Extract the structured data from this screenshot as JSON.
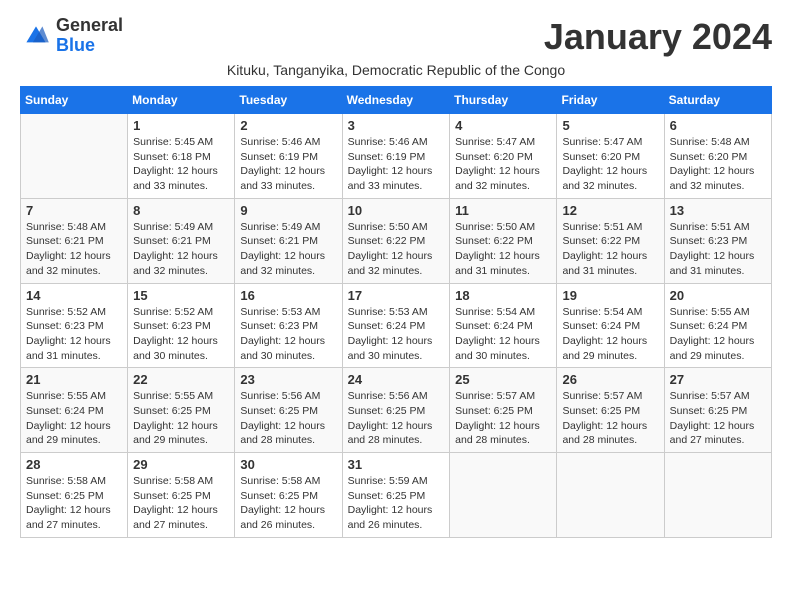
{
  "header": {
    "logo_general": "General",
    "logo_blue": "Blue",
    "title": "January 2024",
    "subtitle": "Kituku, Tanganyika, Democratic Republic of the Congo"
  },
  "calendar": {
    "days_of_week": [
      "Sunday",
      "Monday",
      "Tuesday",
      "Wednesday",
      "Thursday",
      "Friday",
      "Saturday"
    ],
    "weeks": [
      [
        {
          "day": "",
          "info": ""
        },
        {
          "day": "1",
          "info": "Sunrise: 5:45 AM\nSunset: 6:18 PM\nDaylight: 12 hours and 33 minutes."
        },
        {
          "day": "2",
          "info": "Sunrise: 5:46 AM\nSunset: 6:19 PM\nDaylight: 12 hours and 33 minutes."
        },
        {
          "day": "3",
          "info": "Sunrise: 5:46 AM\nSunset: 6:19 PM\nDaylight: 12 hours and 33 minutes."
        },
        {
          "day": "4",
          "info": "Sunrise: 5:47 AM\nSunset: 6:20 PM\nDaylight: 12 hours and 32 minutes."
        },
        {
          "day": "5",
          "info": "Sunrise: 5:47 AM\nSunset: 6:20 PM\nDaylight: 12 hours and 32 minutes."
        },
        {
          "day": "6",
          "info": "Sunrise: 5:48 AM\nSunset: 6:20 PM\nDaylight: 12 hours and 32 minutes."
        }
      ],
      [
        {
          "day": "7",
          "info": "Sunrise: 5:48 AM\nSunset: 6:21 PM\nDaylight: 12 hours and 32 minutes."
        },
        {
          "day": "8",
          "info": "Sunrise: 5:49 AM\nSunset: 6:21 PM\nDaylight: 12 hours and 32 minutes."
        },
        {
          "day": "9",
          "info": "Sunrise: 5:49 AM\nSunset: 6:21 PM\nDaylight: 12 hours and 32 minutes."
        },
        {
          "day": "10",
          "info": "Sunrise: 5:50 AM\nSunset: 6:22 PM\nDaylight: 12 hours and 32 minutes."
        },
        {
          "day": "11",
          "info": "Sunrise: 5:50 AM\nSunset: 6:22 PM\nDaylight: 12 hours and 31 minutes."
        },
        {
          "day": "12",
          "info": "Sunrise: 5:51 AM\nSunset: 6:22 PM\nDaylight: 12 hours and 31 minutes."
        },
        {
          "day": "13",
          "info": "Sunrise: 5:51 AM\nSunset: 6:23 PM\nDaylight: 12 hours and 31 minutes."
        }
      ],
      [
        {
          "day": "14",
          "info": "Sunrise: 5:52 AM\nSunset: 6:23 PM\nDaylight: 12 hours and 31 minutes."
        },
        {
          "day": "15",
          "info": "Sunrise: 5:52 AM\nSunset: 6:23 PM\nDaylight: 12 hours and 30 minutes."
        },
        {
          "day": "16",
          "info": "Sunrise: 5:53 AM\nSunset: 6:23 PM\nDaylight: 12 hours and 30 minutes."
        },
        {
          "day": "17",
          "info": "Sunrise: 5:53 AM\nSunset: 6:24 PM\nDaylight: 12 hours and 30 minutes."
        },
        {
          "day": "18",
          "info": "Sunrise: 5:54 AM\nSunset: 6:24 PM\nDaylight: 12 hours and 30 minutes."
        },
        {
          "day": "19",
          "info": "Sunrise: 5:54 AM\nSunset: 6:24 PM\nDaylight: 12 hours and 29 minutes."
        },
        {
          "day": "20",
          "info": "Sunrise: 5:55 AM\nSunset: 6:24 PM\nDaylight: 12 hours and 29 minutes."
        }
      ],
      [
        {
          "day": "21",
          "info": "Sunrise: 5:55 AM\nSunset: 6:24 PM\nDaylight: 12 hours and 29 minutes."
        },
        {
          "day": "22",
          "info": "Sunrise: 5:55 AM\nSunset: 6:25 PM\nDaylight: 12 hours and 29 minutes."
        },
        {
          "day": "23",
          "info": "Sunrise: 5:56 AM\nSunset: 6:25 PM\nDaylight: 12 hours and 28 minutes."
        },
        {
          "day": "24",
          "info": "Sunrise: 5:56 AM\nSunset: 6:25 PM\nDaylight: 12 hours and 28 minutes."
        },
        {
          "day": "25",
          "info": "Sunrise: 5:57 AM\nSunset: 6:25 PM\nDaylight: 12 hours and 28 minutes."
        },
        {
          "day": "26",
          "info": "Sunrise: 5:57 AM\nSunset: 6:25 PM\nDaylight: 12 hours and 28 minutes."
        },
        {
          "day": "27",
          "info": "Sunrise: 5:57 AM\nSunset: 6:25 PM\nDaylight: 12 hours and 27 minutes."
        }
      ],
      [
        {
          "day": "28",
          "info": "Sunrise: 5:58 AM\nSunset: 6:25 PM\nDaylight: 12 hours and 27 minutes."
        },
        {
          "day": "29",
          "info": "Sunrise: 5:58 AM\nSunset: 6:25 PM\nDaylight: 12 hours and 27 minutes."
        },
        {
          "day": "30",
          "info": "Sunrise: 5:58 AM\nSunset: 6:25 PM\nDaylight: 12 hours and 26 minutes."
        },
        {
          "day": "31",
          "info": "Sunrise: 5:59 AM\nSunset: 6:25 PM\nDaylight: 12 hours and 26 minutes."
        },
        {
          "day": "",
          "info": ""
        },
        {
          "day": "",
          "info": ""
        },
        {
          "day": "",
          "info": ""
        }
      ]
    ]
  }
}
